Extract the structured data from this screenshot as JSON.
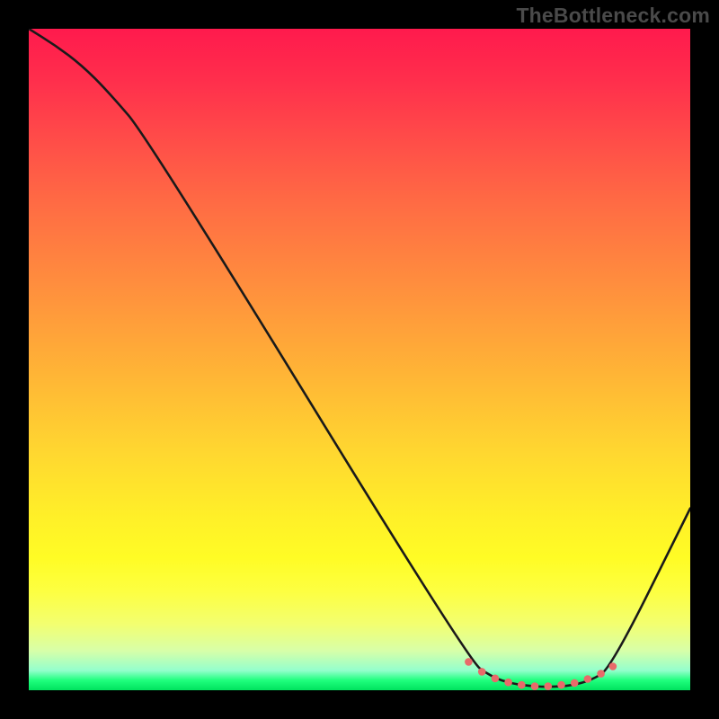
{
  "watermark": "TheBottleneck.com",
  "chart_data": {
    "type": "line",
    "title": "",
    "xlabel": "",
    "ylabel": "",
    "xlim": [
      0,
      1
    ],
    "ylim": [
      0,
      1
    ],
    "series": [
      {
        "name": "curve",
        "x": [
          0.0,
          0.04,
          0.08,
          0.12,
          0.18,
          0.665,
          0.7,
          0.73,
          0.76,
          0.79,
          0.82,
          0.85,
          0.88,
          1.0
        ],
        "y": [
          1.0,
          0.975,
          0.945,
          0.905,
          0.835,
          0.045,
          0.02,
          0.01,
          0.006,
          0.005,
          0.007,
          0.015,
          0.033,
          0.275
        ]
      }
    ],
    "markers": {
      "name": "flat-region-dots",
      "x": [
        0.665,
        0.685,
        0.705,
        0.725,
        0.745,
        0.765,
        0.785,
        0.805,
        0.825,
        0.845,
        0.865,
        0.883
      ],
      "y": [
        0.043,
        0.028,
        0.018,
        0.012,
        0.008,
        0.006,
        0.006,
        0.008,
        0.011,
        0.017,
        0.025,
        0.036
      ]
    },
    "background_gradient": [
      "#ff1a4d",
      "#ffb436",
      "#fff028",
      "#00e25e"
    ]
  }
}
